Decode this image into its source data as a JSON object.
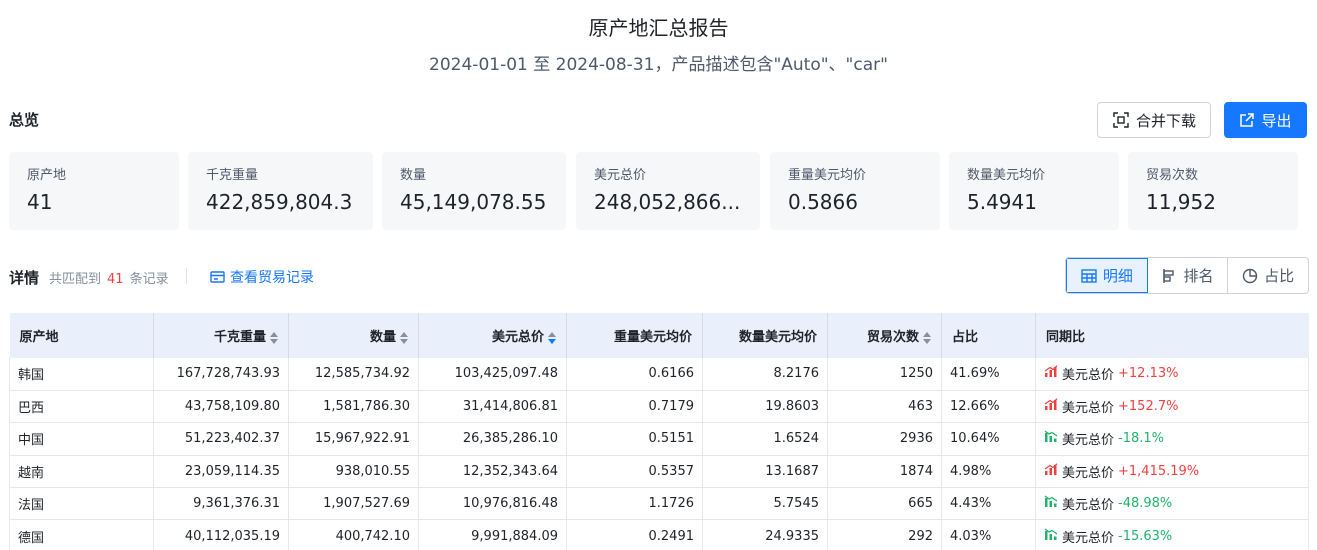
{
  "header": {
    "title": "原产地汇总报告",
    "subtitle": "2024-01-01 至 2024-08-31，产品描述包含\"Auto\"、\"car\""
  },
  "overview": {
    "label": "总览",
    "merge_download_label": "合并下载",
    "export_label": "导出",
    "stats": [
      {
        "label": "原产地",
        "value": "41"
      },
      {
        "label": "千克重量",
        "value": "422,859,804.3"
      },
      {
        "label": "数量",
        "value": "45,149,078.55"
      },
      {
        "label": "美元总价",
        "value": "248,052,866..."
      },
      {
        "label": "重量美元均价",
        "value": "0.5866"
      },
      {
        "label": "数量美元均价",
        "value": "5.4941"
      },
      {
        "label": "贸易次数",
        "value": "11,952"
      }
    ]
  },
  "details": {
    "label": "详情",
    "match_prefix": "共匹配到",
    "match_count": "41",
    "match_suffix": "条记录",
    "view_records_label": "查看贸易记录",
    "views": [
      "明细",
      "排名",
      "占比"
    ],
    "active_view": "明细"
  },
  "table": {
    "columns": [
      "原产地",
      "千克重量",
      "数量",
      "美元总价",
      "重量美元均价",
      "数量美元均价",
      "贸易次数",
      "占比",
      "同期比"
    ],
    "rows": [
      {
        "origin": "韩国",
        "weight": "167,728,743.93",
        "qty": "12,585,734.92",
        "usd": "103,425,097.48",
        "wavg": "0.6166",
        "qavg": "8.2176",
        "trades": "1250",
        "share": "41.69%",
        "yoy_label": "美元总价",
        "yoy": "+12.13%",
        "trend": "up"
      },
      {
        "origin": "巴西",
        "weight": "43,758,109.80",
        "qty": "1,581,786.30",
        "usd": "31,414,806.81",
        "wavg": "0.7179",
        "qavg": "19.8603",
        "trades": "463",
        "share": "12.66%",
        "yoy_label": "美元总价",
        "yoy": "+152.7%",
        "trend": "up"
      },
      {
        "origin": "中国",
        "weight": "51,223,402.37",
        "qty": "15,967,922.91",
        "usd": "26,385,286.10",
        "wavg": "0.5151",
        "qavg": "1.6524",
        "trades": "2936",
        "share": "10.64%",
        "yoy_label": "美元总价",
        "yoy": "-18.1%",
        "trend": "down"
      },
      {
        "origin": "越南",
        "weight": "23,059,114.35",
        "qty": "938,010.55",
        "usd": "12,352,343.64",
        "wavg": "0.5357",
        "qavg": "13.1687",
        "trades": "1874",
        "share": "4.98%",
        "yoy_label": "美元总价",
        "yoy": "+1,415.19%",
        "trend": "up"
      },
      {
        "origin": "法国",
        "weight": "9,361,376.31",
        "qty": "1,907,527.69",
        "usd": "10,976,816.48",
        "wavg": "1.1726",
        "qavg": "5.7545",
        "trades": "665",
        "share": "4.43%",
        "yoy_label": "美元总价",
        "yoy": "-48.98%",
        "trend": "down"
      },
      {
        "origin": "德国",
        "weight": "40,112,035.19",
        "qty": "400,742.10",
        "usd": "9,991,884.09",
        "wavg": "0.2491",
        "qavg": "24.9335",
        "trades": "292",
        "share": "4.03%",
        "yoy_label": "美元总价",
        "yoy": "-15.63%",
        "trend": "down"
      }
    ]
  },
  "colors": {
    "accent": "#1677ff",
    "up": "#f53f3f",
    "down": "#21b36b"
  },
  "icons": {
    "merge": "merge-icon",
    "export": "export-icon",
    "records": "card-icon",
    "detail": "table-icon",
    "rank": "ranking-icon",
    "share": "pie-icon",
    "trend_up": "bar-up-icon",
    "trend_down": "bar-down-icon"
  }
}
